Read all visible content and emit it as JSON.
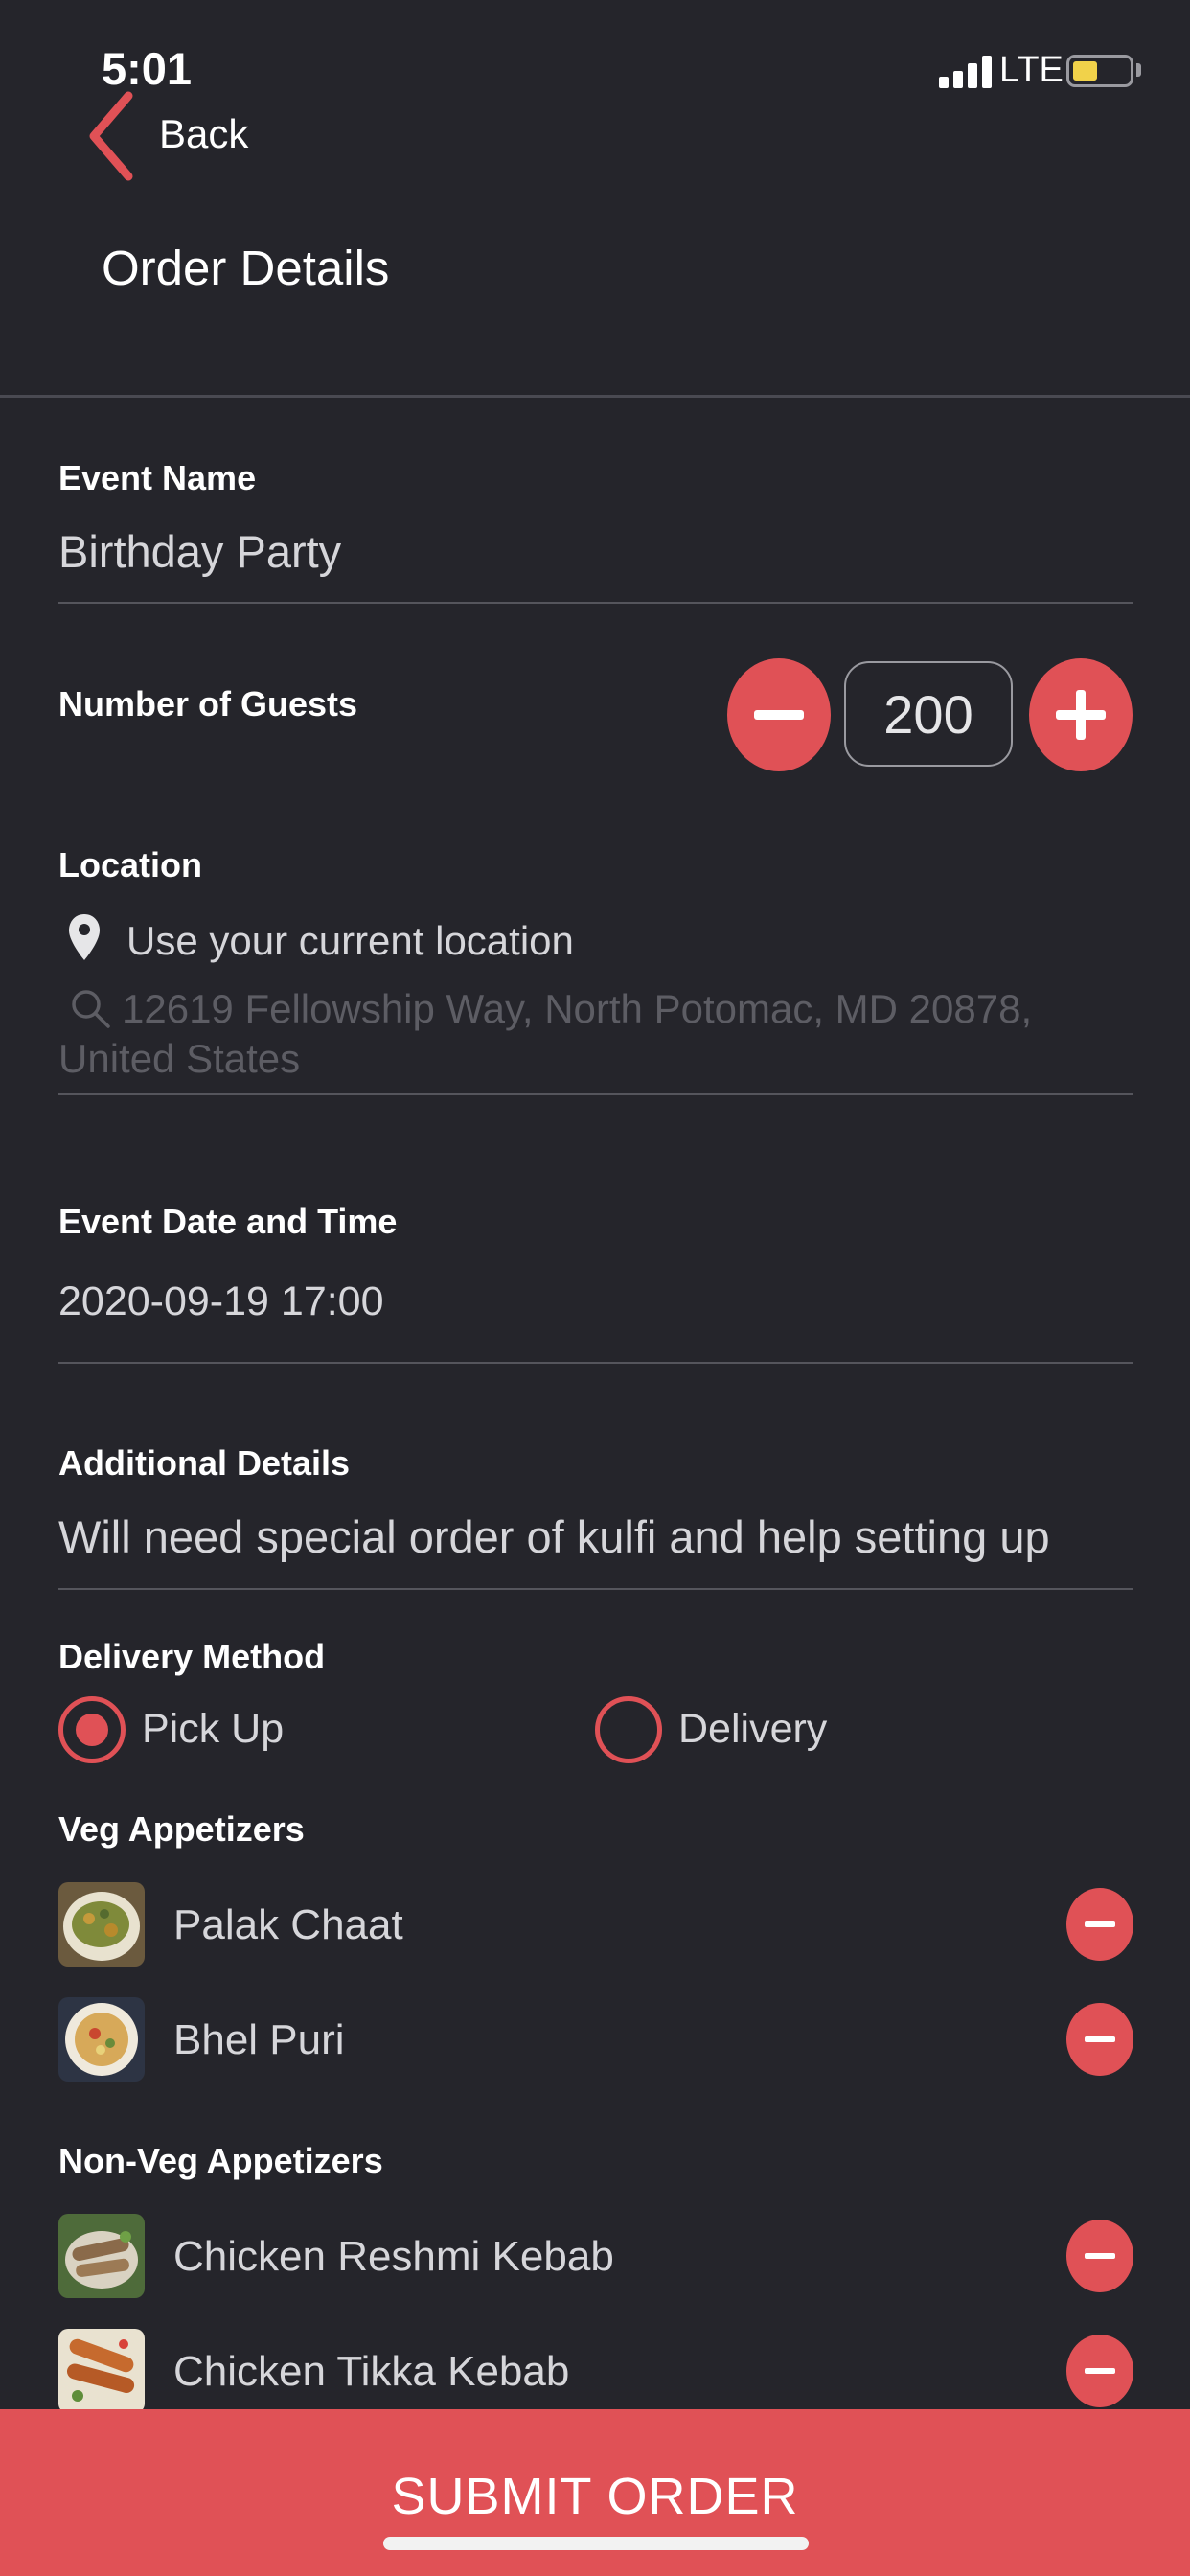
{
  "status_bar": {
    "time": "5:01",
    "network": "LTE",
    "battery_level": 0.45,
    "battery_color": "#f1d24a"
  },
  "nav": {
    "back_label": "Back",
    "title": "Order Details"
  },
  "form": {
    "event_name": {
      "label": "Event Name",
      "value": "Birthday Party"
    },
    "guests": {
      "label": "Number of Guests",
      "value": "200"
    },
    "location": {
      "label": "Location",
      "current_location_label": "Use your current location",
      "search_placeholder_line1": "12619 Fellowship Way, North Potomac, MD  20878,",
      "search_placeholder_line2": "United States"
    },
    "event_datetime": {
      "label": "Event Date and Time",
      "value": "2020-09-19 17:00"
    },
    "additional_details": {
      "label": "Additional Details",
      "value": "Will need special order of kulfi and help setting up"
    },
    "delivery_method": {
      "label": "Delivery Method",
      "options": [
        "Pick Up",
        "Delivery"
      ],
      "selected": "Pick Up"
    }
  },
  "menu_sections": [
    {
      "title": "Veg Appetizers",
      "items": [
        "Palak Chaat",
        "Bhel Puri"
      ]
    },
    {
      "title": "Non-Veg Appetizers",
      "items": [
        "Chicken Reshmi Kebab",
        "Chicken Tikka Kebab"
      ]
    }
  ],
  "submit": {
    "label": "SUBMIT ORDER"
  },
  "colors": {
    "accent": "#e05156",
    "background": "#25252b",
    "text": "#e6e6e8"
  },
  "icons": [
    "chevron-left-icon",
    "location-pin-icon",
    "search-icon",
    "minus-icon",
    "plus-icon",
    "signal-icon",
    "battery-icon"
  ]
}
